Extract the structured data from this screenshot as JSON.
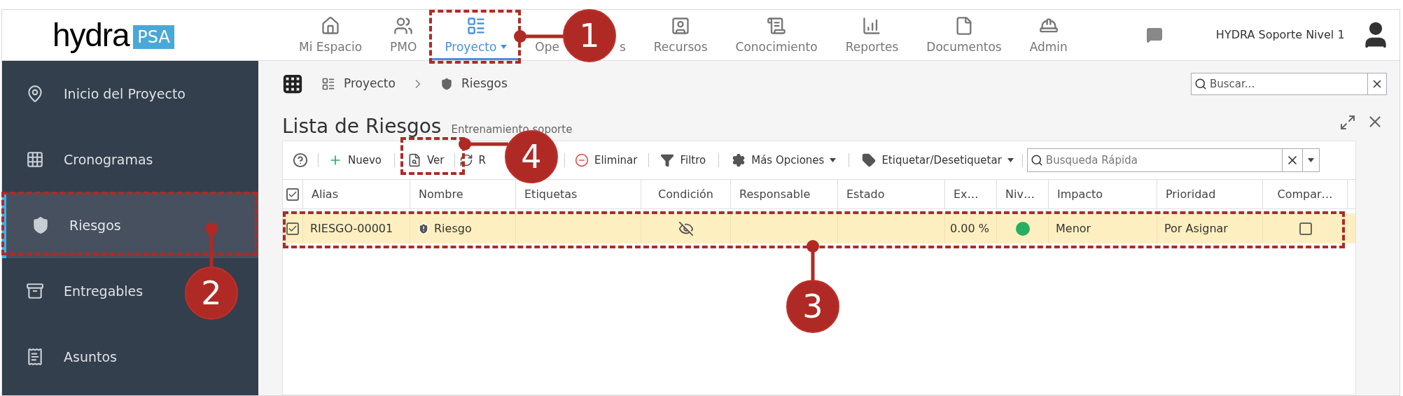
{
  "logo": {
    "name": "hydra",
    "badge": "PSA"
  },
  "nav": [
    {
      "label": "Mi Espacio",
      "selected": false
    },
    {
      "label": "PMO",
      "selected": false
    },
    {
      "label": "Proyecto",
      "selected": true
    },
    {
      "label": "Ope",
      "label_tail": "s",
      "selected": false
    },
    {
      "label": "Recursos",
      "selected": false
    },
    {
      "label": "Conocimiento",
      "selected": false
    },
    {
      "label": "Reportes",
      "selected": false
    },
    {
      "label": "Documentos",
      "selected": false
    },
    {
      "label": "Admin",
      "selected": false
    }
  ],
  "user": {
    "name": "HYDRA Soporte Nivel 1"
  },
  "sidebar": {
    "items": [
      {
        "label": "Inicio del Proyecto",
        "selected": false
      },
      {
        "label": "Cronogramas",
        "selected": false
      },
      {
        "label": "Riesgos",
        "selected": true
      },
      {
        "label": "Entregables",
        "selected": false
      },
      {
        "label": "Asuntos",
        "selected": false
      }
    ]
  },
  "breadcrumb": [
    "Proyecto",
    "Riesgos"
  ],
  "search": {
    "placeholder": "Buscar..."
  },
  "page": {
    "title": "Lista de Riesgos",
    "subtitle": "Entrenamiento soporte"
  },
  "toolbar": [
    {
      "label": "Nuevo"
    },
    {
      "label": "Ver"
    },
    {
      "label": "R"
    },
    {
      "label": "Eliminar"
    },
    {
      "label": "Filtro"
    },
    {
      "label": "Más Opciones"
    },
    {
      "label": "Etiquetar/Desetiquetar"
    }
  ],
  "quick_search": {
    "placeholder": "Busqueda Rápida"
  },
  "table": {
    "select_all_checked": true,
    "columns": [
      "Alias",
      "Nombre",
      "Etiquetas",
      "Condición",
      "Responsable",
      "Estado",
      "Ex…",
      "Niv…",
      "Impacto",
      "Prioridad",
      "Compar…"
    ],
    "rows": [
      {
        "selected": true,
        "alias": "RIESGO-00001",
        "nombre": "Riesgo",
        "avance": "0.00 %",
        "nivel": {
          "color": "#27ae60"
        },
        "impacto": "Menor",
        "prioridad": "Por Asignar",
        "compartido": false
      }
    ]
  },
  "annotations": [
    {
      "number": "1"
    },
    {
      "number": "2"
    },
    {
      "number": "3"
    },
    {
      "number": "4"
    }
  ]
}
